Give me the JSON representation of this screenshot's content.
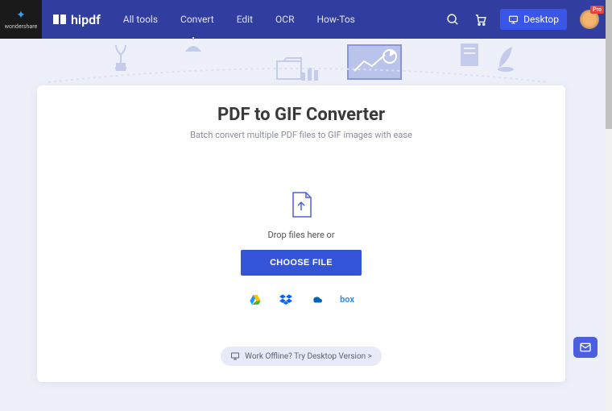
{
  "brand": {
    "ws_label": "wondershare",
    "name": "hipdf"
  },
  "nav": {
    "all_tools": "All tools",
    "convert": "Convert",
    "edit": "Edit",
    "ocr": "OCR",
    "howtos": "How-Tos"
  },
  "desktop_btn": "Desktop",
  "avatar_badge": "Pro",
  "page": {
    "title": "PDF to GIF Converter",
    "subtitle": "Batch convert multiple PDF files to GIF images with ease"
  },
  "dropzone": {
    "label": "Drop files here or",
    "button": "CHOOSE FILE"
  },
  "cloud": {
    "drive": "google-drive",
    "dropbox": "dropbox",
    "onedrive": "onedrive",
    "box": "box"
  },
  "offline_pill": "Work Offline? Try Desktop Version >"
}
